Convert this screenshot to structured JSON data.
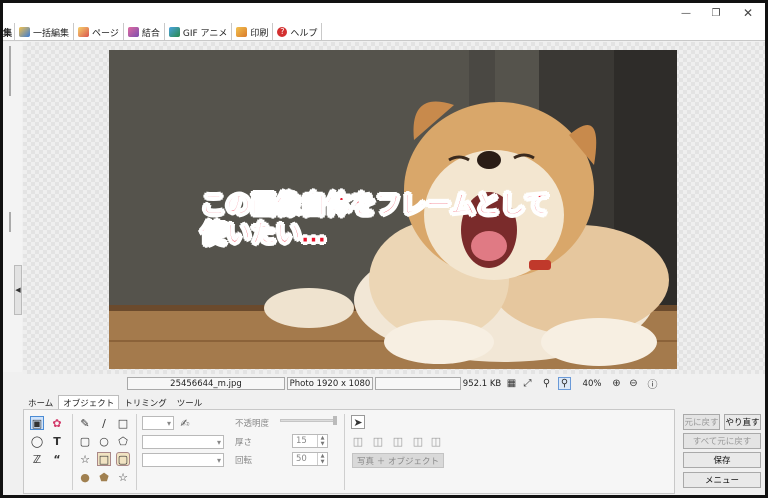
{
  "top_tabs": [
    {
      "label": "集",
      "icon": "edit-icon",
      "color": ""
    },
    {
      "label": "一括編集",
      "icon": "batch-edit-icon",
      "color": "#3a7bd5"
    },
    {
      "label": "ページ",
      "icon": "page-icon",
      "color": "#d9534f"
    },
    {
      "label": "結合",
      "icon": "combine-icon",
      "color": "#7b4fb0"
    },
    {
      "label": "GIF アニメ",
      "icon": "gif-animation-icon",
      "color": "#2a8a4a"
    },
    {
      "label": "印刷",
      "icon": "print-icon",
      "color": "#d97a2b"
    },
    {
      "label": "ヘルプ",
      "icon": "help-icon",
      "color": "#d32f2f"
    }
  ],
  "photo": {
    "caption_line1": "この画像自体をフレームとして",
    "caption_line2": "使いたい…"
  },
  "status": {
    "filename": "25456644_m.jpg",
    "image_info": "Photo 1920 x 1080",
    "empty": "",
    "filesize": "952.1 KB",
    "zoom": "40%"
  },
  "ribbon_tabs": [
    {
      "label": "ホーム",
      "active": false
    },
    {
      "label": "オブジェクト",
      "active": true
    },
    {
      "label": "トリミング",
      "active": false
    },
    {
      "label": "ツール",
      "active": false
    }
  ],
  "object_panel": {
    "opacity_label": "不透明度",
    "thickness_label": "厚さ",
    "thickness_value": "15",
    "rotation_label": "回転",
    "rotation_value": "50",
    "photo_object_button": "写真 ＋ オブジェクト"
  },
  "right_buttons": {
    "undo": "元に戻す",
    "redo": "やり直す",
    "undo_all": "すべて元に戻す",
    "save": "保存",
    "menu": "メニュー"
  },
  "colors": {
    "caption_red": "#e8112a",
    "accent_blue": "#3a7bd5"
  }
}
